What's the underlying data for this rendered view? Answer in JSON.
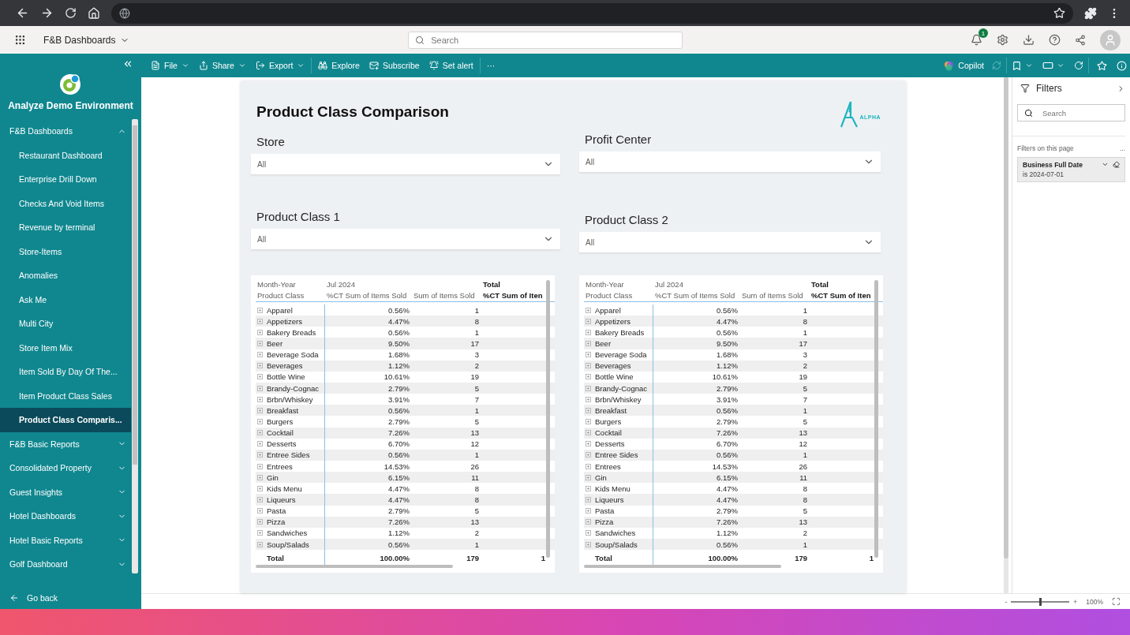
{
  "app_header": {
    "workspace": "F&B Dashboards",
    "search": {
      "placeholder": "Search"
    },
    "notifications": {
      "count": "1"
    }
  },
  "sidebar": {
    "title": "Analyze Demo Environment",
    "groups": [
      {
        "label": "F&B Dashboards",
        "expanded": true,
        "children": [
          {
            "label": "Restaurant Dashboard",
            "selected": false
          },
          {
            "label": "Enterprise Drill Down",
            "selected": false
          },
          {
            "label": "Checks And Void Items",
            "selected": false
          },
          {
            "label": "Revenue by terminal",
            "selected": false
          },
          {
            "label": "Store-Items",
            "selected": false
          },
          {
            "label": "Anomalies",
            "selected": false
          },
          {
            "label": "Ask Me",
            "selected": false
          },
          {
            "label": "Multi City",
            "selected": false
          },
          {
            "label": "Store Item Mix",
            "selected": false
          },
          {
            "label": "Item Sold By Day Of The...",
            "selected": false
          },
          {
            "label": "Item Product Class Sales",
            "selected": false
          },
          {
            "label": "Product Class Comparis...",
            "selected": true
          }
        ]
      },
      {
        "label": "F&B Basic Reports",
        "expanded": false
      },
      {
        "label": "Consolidated Property",
        "expanded": false
      },
      {
        "label": "Guest Insights",
        "expanded": false
      },
      {
        "label": "Hotel Dashboards",
        "expanded": false
      },
      {
        "label": "Hotel Basic Reports",
        "expanded": false
      },
      {
        "label": "Golf Dashboard",
        "expanded": false
      }
    ],
    "back": "Go back"
  },
  "toolbar": {
    "items": [
      {
        "label": "File",
        "dropdown": true
      },
      {
        "label": "Share",
        "dropdown": true
      },
      {
        "label": "Export",
        "dropdown": true
      },
      {
        "label": "Explore",
        "dropdown": false
      },
      {
        "label": "Subscribe",
        "dropdown": false
      },
      {
        "label": "Set alert",
        "dropdown": false
      },
      {
        "label": "···",
        "dropdown": false
      }
    ],
    "copilot": "Copilot"
  },
  "report": {
    "title": "Product Class Comparison",
    "logo": "ALPHA",
    "slicers": [
      {
        "label": "Store",
        "value": "All"
      },
      {
        "label": "Profit Center",
        "value": "All"
      },
      {
        "label": "Product Class 1",
        "value": "All"
      },
      {
        "label": "Product Class 2",
        "value": "All"
      }
    ],
    "tables": [
      {
        "header_top": {
          "row_label": "Month-Year",
          "period": "Jul 2024",
          "total": "Total"
        },
        "header": [
          "Product Class",
          "%CT Sum of Items Sold",
          "Sum of Items Sold",
          "%CT Sum of Iten"
        ],
        "rows": [
          [
            "Apparel",
            "0.56%",
            "1"
          ],
          [
            "Appetizers",
            "4.47%",
            "8"
          ],
          [
            "Bakery Breads",
            "0.56%",
            "1"
          ],
          [
            "Beer",
            "9.50%",
            "17"
          ],
          [
            "Beverage Soda",
            "1.68%",
            "3"
          ],
          [
            "Beverages",
            "1.12%",
            "2"
          ],
          [
            "Bottle Wine",
            "10.61%",
            "19"
          ],
          [
            "Brandy-Cognac",
            "2.79%",
            "5"
          ],
          [
            "Brbn/Whiskey",
            "3.91%",
            "7"
          ],
          [
            "Breakfast",
            "0.56%",
            "1"
          ],
          [
            "Burgers",
            "2.79%",
            "5"
          ],
          [
            "Cocktail",
            "7.26%",
            "13"
          ],
          [
            "Desserts",
            "6.70%",
            "12"
          ],
          [
            "Entree Sides",
            "0.56%",
            "1"
          ],
          [
            "Entrees",
            "14.53%",
            "26"
          ],
          [
            "Gin",
            "6.15%",
            "11"
          ],
          [
            "Kids Menu",
            "4.47%",
            "8"
          ],
          [
            "Liqueurs",
            "4.47%",
            "8"
          ],
          [
            "Pasta",
            "2.79%",
            "5"
          ],
          [
            "Pizza",
            "7.26%",
            "13"
          ],
          [
            "Sandwiches",
            "1.12%",
            "2"
          ],
          [
            "Soup/Salads",
            "0.56%",
            "1"
          ]
        ],
        "total": [
          "Total",
          "100.00%",
          "179",
          "1"
        ]
      },
      {
        "header_top": {
          "row_label": "Month-Year",
          "period": "Jul 2024",
          "total": "Total"
        },
        "header": [
          "Product Class",
          "%CT Sum of Items Sold",
          "Sum of Items Sold",
          "%CT Sum of Iten"
        ],
        "rows": [
          [
            "Apparel",
            "0.56%",
            "1"
          ],
          [
            "Appetizers",
            "4.47%",
            "8"
          ],
          [
            "Bakery Breads",
            "0.56%",
            "1"
          ],
          [
            "Beer",
            "9.50%",
            "17"
          ],
          [
            "Beverage Soda",
            "1.68%",
            "3"
          ],
          [
            "Beverages",
            "1.12%",
            "2"
          ],
          [
            "Bottle Wine",
            "10.61%",
            "19"
          ],
          [
            "Brandy-Cognac",
            "2.79%",
            "5"
          ],
          [
            "Brbn/Whiskey",
            "3.91%",
            "7"
          ],
          [
            "Breakfast",
            "0.56%",
            "1"
          ],
          [
            "Burgers",
            "2.79%",
            "5"
          ],
          [
            "Cocktail",
            "7.26%",
            "13"
          ],
          [
            "Desserts",
            "6.70%",
            "12"
          ],
          [
            "Entree Sides",
            "0.56%",
            "1"
          ],
          [
            "Entrees",
            "14.53%",
            "26"
          ],
          [
            "Gin",
            "6.15%",
            "11"
          ],
          [
            "Kids Menu",
            "4.47%",
            "8"
          ],
          [
            "Liqueurs",
            "4.47%",
            "8"
          ],
          [
            "Pasta",
            "2.79%",
            "5"
          ],
          [
            "Pizza",
            "7.26%",
            "13"
          ],
          [
            "Sandwiches",
            "1.12%",
            "2"
          ],
          [
            "Soup/Salads",
            "0.56%",
            "1"
          ]
        ],
        "total": [
          "Total",
          "100.00%",
          "179",
          "1"
        ]
      }
    ]
  },
  "filters": {
    "title": "Filters",
    "search": {
      "placeholder": "Search"
    },
    "section": "Filters on this page",
    "section_more": "...",
    "cards": [
      {
        "title": "Business Full Date",
        "detail": "is 2024-07-01"
      }
    ]
  },
  "status_bar": {
    "zoom": {
      "level": 0.5,
      "minus": "-",
      "plus": "+",
      "reading": "100%"
    }
  }
}
